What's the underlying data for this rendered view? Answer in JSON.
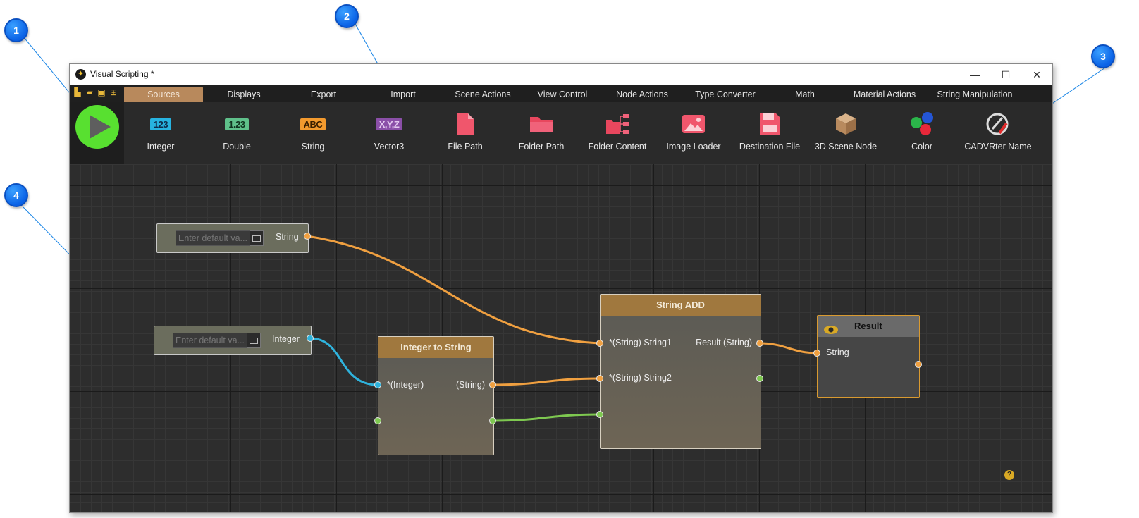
{
  "callouts": [
    "1",
    "2",
    "3",
    "4"
  ],
  "window": {
    "title": "Visual Scripting *",
    "minimize": "—",
    "maximize": "☐",
    "close": "✕"
  },
  "menu": {
    "tabs": [
      "Sources",
      "Displays",
      "Export",
      "Import",
      "Scene Actions",
      "View Control",
      "Node Actions",
      "Type Converter",
      "Math",
      "Material Actions",
      "String Manipulation"
    ],
    "active": "Sources"
  },
  "toolbar": {
    "badges": {
      "integer": "123",
      "double": "1.23",
      "string": "ABC",
      "vector3": "X,Y,Z"
    },
    "tools": [
      "Integer",
      "Double",
      "String",
      "Vector3",
      "File Path",
      "Folder Path",
      "Folder Content",
      "Image Loader",
      "Destination File",
      "3D Scene Node",
      "Color",
      "CADVRter Name"
    ]
  },
  "canvas": {
    "string_source": {
      "placeholder": "Enter default va...",
      "output": "String"
    },
    "integer_source": {
      "placeholder": "Enter default va...",
      "output": "Integer"
    },
    "integer_to_string": {
      "title": "Integer to String",
      "input": "*(Integer)",
      "output": "(String)"
    },
    "string_add": {
      "title": "String ADD",
      "input1": "*(String) String1",
      "input2": "*(String) String2",
      "output": "Result (String)"
    },
    "result": {
      "title": "Result",
      "input": "String"
    },
    "help": "?"
  },
  "colors": {
    "wire_string": "#f0a040",
    "wire_integer": "#2fb3dd",
    "wire_exec": "#7ec850",
    "active_tab": "#b8895c",
    "node_header": "#a0783e"
  }
}
